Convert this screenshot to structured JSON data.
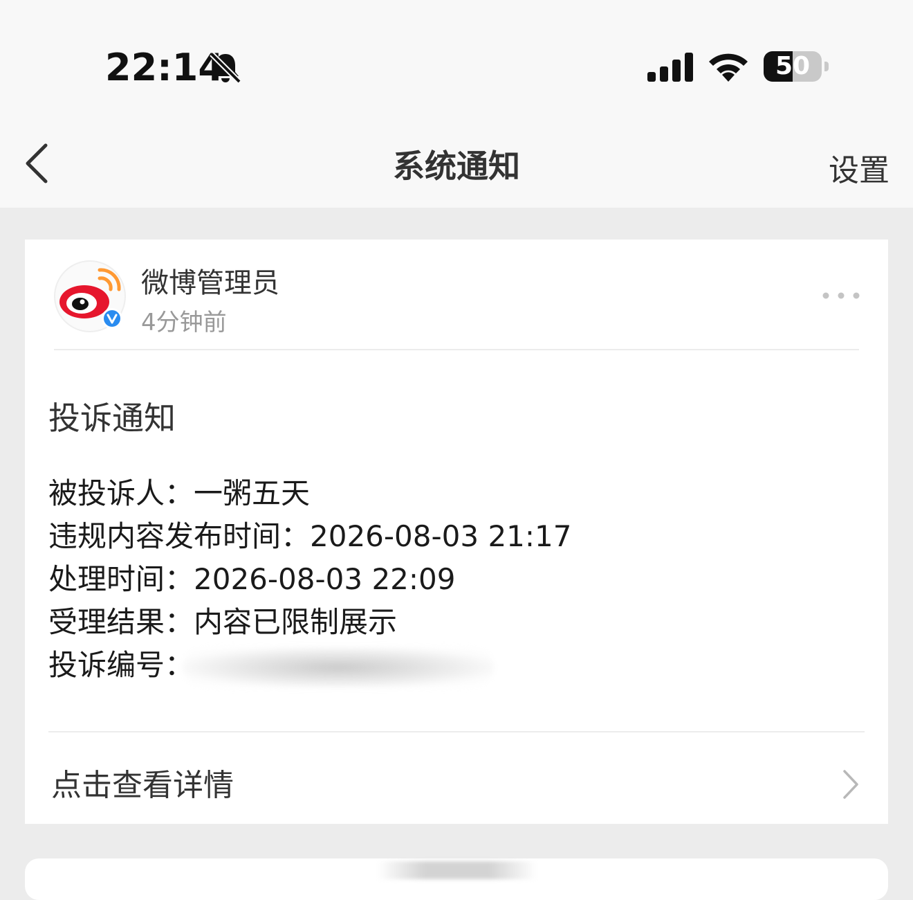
{
  "status_bar": {
    "time": "22:14",
    "battery_level": "50",
    "battery_fraction": 0.5,
    "icons": [
      "bell-slash-icon",
      "cellular-signal-icon",
      "wifi-icon",
      "battery-icon"
    ]
  },
  "nav": {
    "title": "系统通知",
    "settings_label": "设置",
    "back_icon": "chevron-left-icon"
  },
  "notification": {
    "sender_name": "微博管理员",
    "sender_time": "4分钟前",
    "title": "投诉通知",
    "fields": [
      {
        "label": "被投诉人：",
        "value": "一粥五天"
      },
      {
        "label": "违规内容发布时间：",
        "value": "2026-08-03 21:17"
      },
      {
        "label": "处理时间：",
        "value": "2026-08-03 22:09"
      },
      {
        "label": "受理结果：",
        "value": "内容已限制展示"
      },
      {
        "label": "投诉编号：",
        "value": ""
      }
    ],
    "details_label": "点击查看详情"
  },
  "colors": {
    "page_bg": "#ececec",
    "bar_bg": "#f8f8f8",
    "card_bg": "#ffffff",
    "weibo_red": "#e6162d",
    "weibo_orange": "#ff9933",
    "verified_blue": "#2a8cf0"
  }
}
